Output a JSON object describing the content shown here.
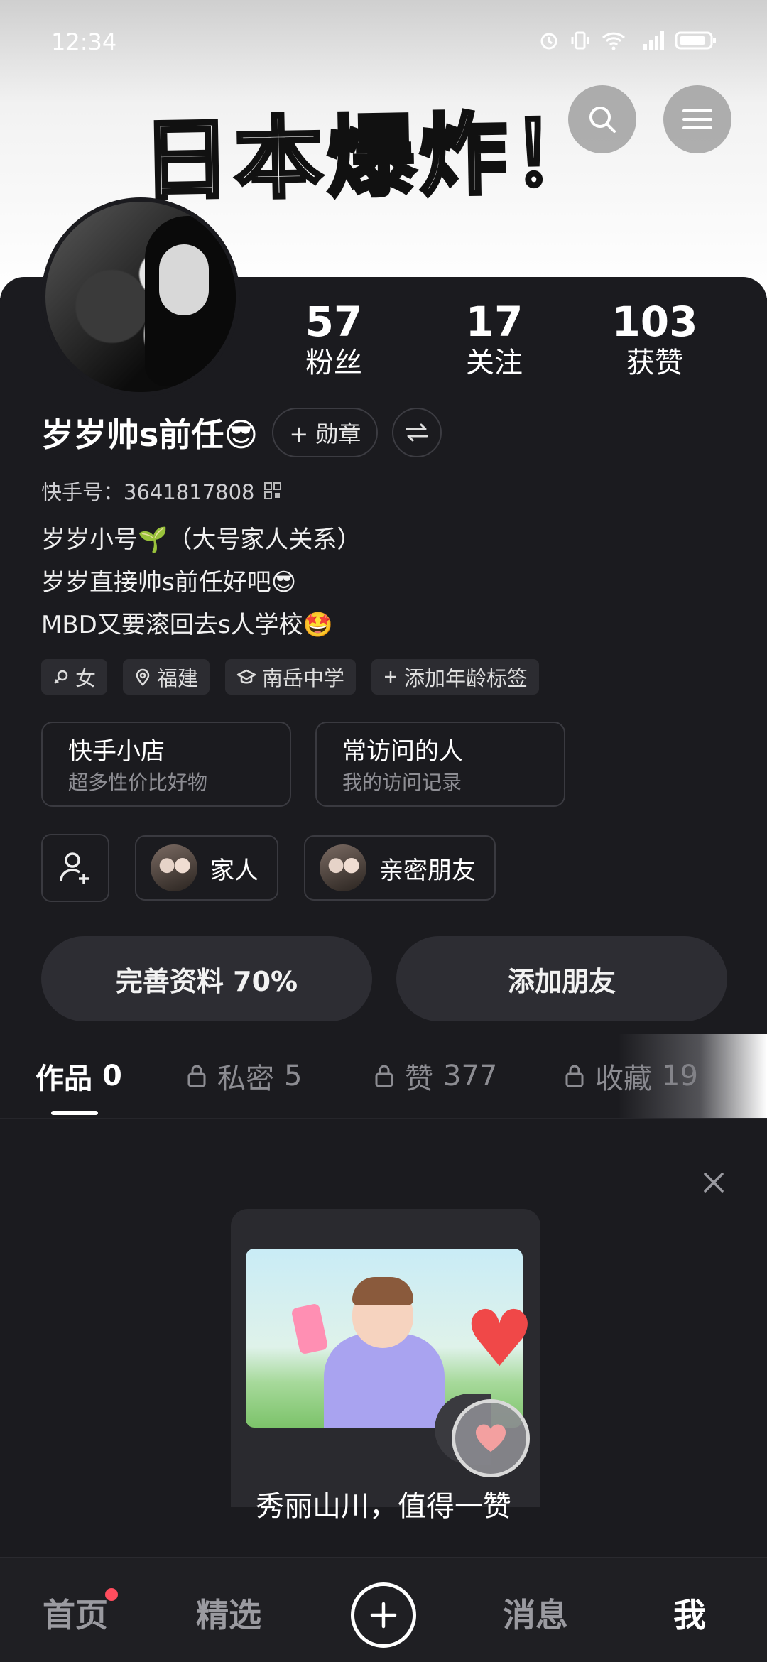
{
  "status_bar": {
    "time": "12:34"
  },
  "banner": {
    "title": "日本爆炸！"
  },
  "profile": {
    "stats": [
      {
        "value": "57",
        "label": "粉丝"
      },
      {
        "value": "17",
        "label": "关注"
      },
      {
        "value": "103",
        "label": "获赞"
      }
    ],
    "username": "岁岁帅s前任😎",
    "badge_button": "+ 勋章",
    "kuaishou_id": "快手号：3641817808",
    "bio": [
      "岁岁小号🌱（大号家人关系）",
      "岁岁直接帅s前任好吧😎",
      "MBD又要滚回去s人学校🤩"
    ],
    "tags": [
      {
        "icon": "female-icon",
        "label": "女"
      },
      {
        "icon": "location-icon",
        "label": "福建"
      },
      {
        "icon": "school-icon",
        "label": "南岳中学"
      },
      {
        "icon": "plus-icon",
        "label": "添加年龄标签"
      }
    ],
    "entries": [
      {
        "title": "快手小店",
        "subtitle": "超多性价比好物"
      },
      {
        "title": "常访问的人",
        "subtitle": "我的访问记录"
      }
    ],
    "groups": [
      {
        "label": "家人"
      },
      {
        "label": "亲密朋友"
      }
    ],
    "actions": {
      "complete_profile": "完善资料 70%",
      "add_friend": "添加朋友"
    }
  },
  "tabs": [
    {
      "label": "作品",
      "count": "0",
      "locked": false
    },
    {
      "label": "私密",
      "count": "5",
      "locked": true
    },
    {
      "label": "赞",
      "count": "377",
      "locked": true
    },
    {
      "label": "收藏",
      "count": "19",
      "locked": true
    }
  ],
  "empty_state": {
    "text": "秀丽山川，值得一赞"
  },
  "bottom_nav": {
    "home": "首页",
    "featured": "精选",
    "messages": "消息",
    "me": "我"
  },
  "colors": {
    "background": "#1b1b1f",
    "notification_dot": "#ff4d5e",
    "heart": "#f04848"
  }
}
